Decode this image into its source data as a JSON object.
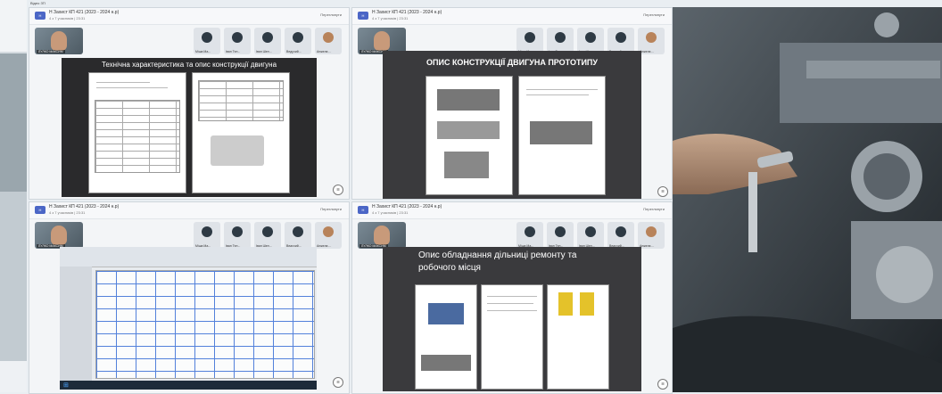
{
  "session": {
    "title": "Н Захист КП 421 (2023 - 2024 н.р) ",
    "subtitle": "4 з 7 учасників | 23:31",
    "view_button": "Переглянути",
    "self_label": "ЛУЛКО МАКСИМ",
    "participants": [
      "Міша Ма...",
      "Іван Тел...",
      "Іван Шел...",
      "Ведучий...",
      "Анжела ..."
    ]
  },
  "window_label": "Відео ЗП",
  "slides": [
    {
      "title": "Технічна характеристика та опис конструкції двигуна"
    },
    {
      "title": "ОПИС КОНСТРУКЦІЇ ДВИГУНА ПРОТОТИПУ"
    },
    {
      "title": ""
    },
    {
      "title_line1": "Опис обладнання дільниці ремонту та",
      "title_line2": "робочого місця"
    }
  ],
  "colors": {
    "accent": "#1f7ad6",
    "stage": "#2a2a2c"
  },
  "icons": [
    "teams-badge-icon",
    "more-icon",
    "person-avatar-icon",
    "windows-start-icon"
  ]
}
